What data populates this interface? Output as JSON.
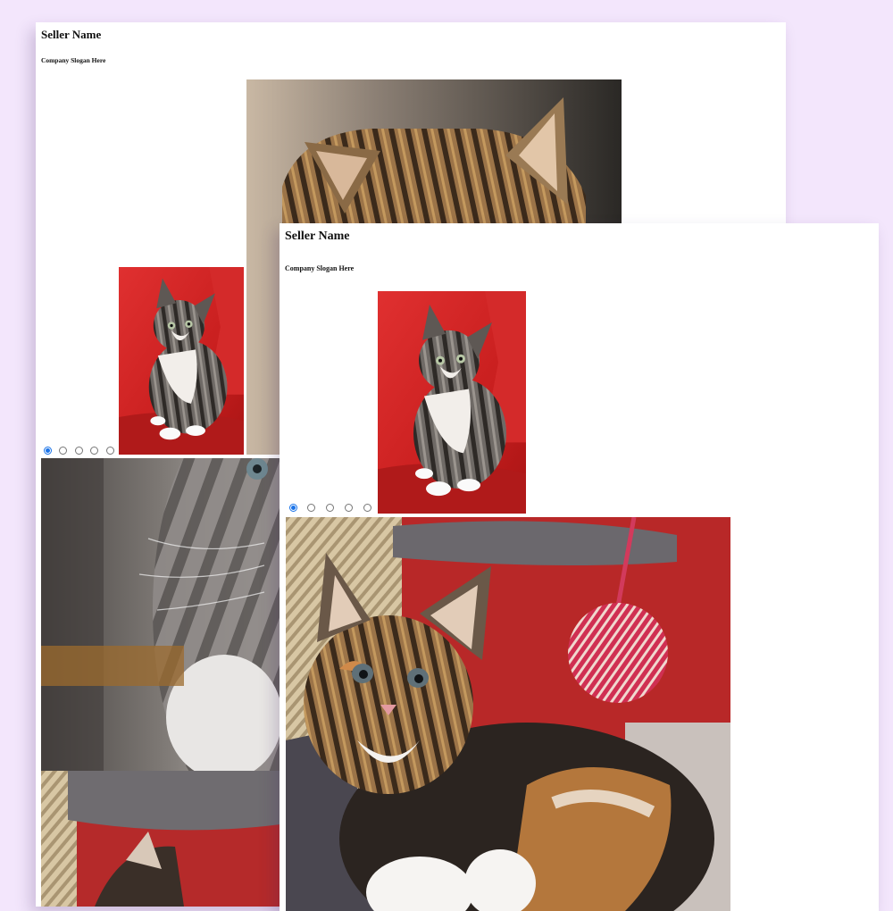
{
  "windows": [
    {
      "seller_name": "Seller Name",
      "slogan": "Company Slogan Here",
      "carousel": {
        "selected_index": 0,
        "radio_count": 5
      }
    },
    {
      "seller_name": "Seller Name",
      "slogan": "Company Slogan Here",
      "carousel": {
        "selected_index": 0,
        "radio_count": 5
      }
    }
  ],
  "colors": {
    "page_background": "#f3e6fc",
    "radio_selected": "#1a73e8",
    "cushion_red": "#cc2222"
  },
  "images": [
    "tabby-kitten-closeup-photo",
    "kitten-on-red-cushion-photo",
    "grey-kitten-blurred-photo",
    "calico-kitten-with-yarn-ball-photo"
  ]
}
